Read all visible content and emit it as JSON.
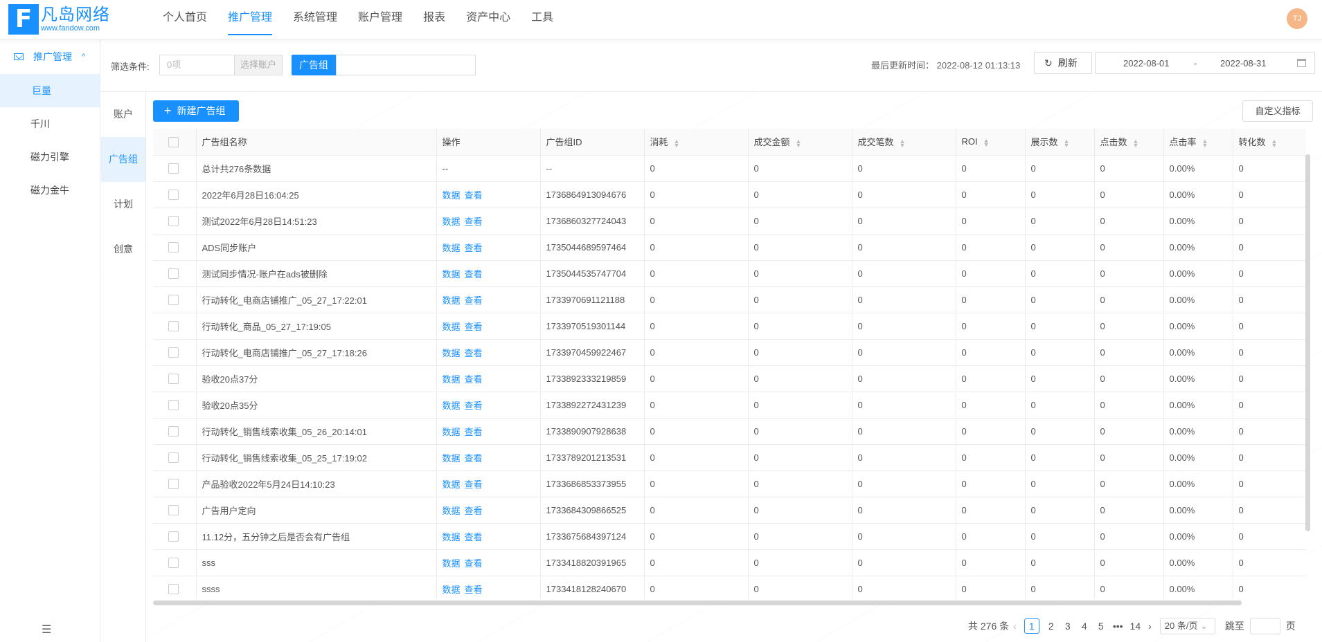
{
  "header": {
    "logo_letter": "F",
    "logo_cn": "凡岛网络",
    "logo_en": "www.fandow.com",
    "nav": [
      "个人首页",
      "推广管理",
      "系统管理",
      "账户管理",
      "报表",
      "资产中心",
      "工具"
    ],
    "active_nav": 1,
    "avatar": "TJ"
  },
  "sidebar": {
    "group": "推广管理",
    "items": [
      "巨量",
      "千川",
      "磁力引擎",
      "磁力金牛"
    ],
    "active": 0
  },
  "subbar": {
    "items": [
      "账户",
      "广告组",
      "计划",
      "创意"
    ],
    "active": 1
  },
  "filter": {
    "label": "筛选条件:",
    "count": "0项",
    "pick": "选择账户",
    "tag": "广告组",
    "update_label": "最后更新时间：",
    "update_time": "2022-08-12 01:13:13",
    "refresh": "刷新",
    "date_start": "2022-08-01",
    "date_sep": "-",
    "date_end": "2022-08-31"
  },
  "toolbar": {
    "new_button": "新建广告组",
    "custom_button": "自定义指标"
  },
  "table": {
    "columns": [
      "广告组名称",
      "操作",
      "广告组ID",
      "消耗",
      "成交金额",
      "成交笔数",
      "ROI",
      "展示数",
      "点击数",
      "点击率",
      "转化数"
    ],
    "sortable": [
      false,
      false,
      false,
      true,
      true,
      true,
      true,
      true,
      true,
      true,
      true
    ],
    "op_links": [
      "数据",
      "查看"
    ],
    "summary": [
      "总计共276条数据",
      "--",
      "--",
      "0",
      "0",
      "0",
      "0",
      "0",
      "0",
      "0.00%",
      "0"
    ],
    "rows": [
      [
        "2022年6月28日16:04:25",
        "1736864913094676"
      ],
      [
        "测试2022年6月28日14:51:23",
        "1736860327724043"
      ],
      [
        "ADS同步账户",
        "1735044689597464"
      ],
      [
        "测试同步情况-账户在ads被删除",
        "1735044535747704"
      ],
      [
        "行动转化_电商店铺推广_05_27_17:22:01",
        "1733970691121188"
      ],
      [
        "行动转化_商品_05_27_17:19:05",
        "1733970519301144"
      ],
      [
        "行动转化_电商店铺推广_05_27_17:18:26",
        "1733970459922467"
      ],
      [
        "验收20点37分",
        "1733892333219859"
      ],
      [
        "验收20点35分",
        "1733892272431239"
      ],
      [
        "行动转化_销售线索收集_05_26_20:14:01",
        "1733890907928638"
      ],
      [
        "行动转化_销售线索收集_05_25_17:19:02",
        "1733789201213531"
      ],
      [
        "产品验收2022年5月24日14:10:23",
        "1733686853373955"
      ],
      [
        "广告用户定向",
        "1733684309866525"
      ],
      [
        "11.12分，五分钟之后是否会有广告组",
        "1733675684397124"
      ],
      [
        "sss",
        "1733418820391965"
      ],
      [
        "ssss",
        "1733418128240670"
      ]
    ],
    "metric_values": [
      "0",
      "0",
      "0",
      "0",
      "0",
      "0",
      "0.00%",
      "0"
    ]
  },
  "pager": {
    "total": "共 276 条",
    "pages": [
      "1",
      "2",
      "3",
      "4",
      "5",
      "•••",
      "14"
    ],
    "active_page": "1",
    "size": "20 条/页",
    "jump_label": "跳至",
    "page_suffix": "页"
  }
}
